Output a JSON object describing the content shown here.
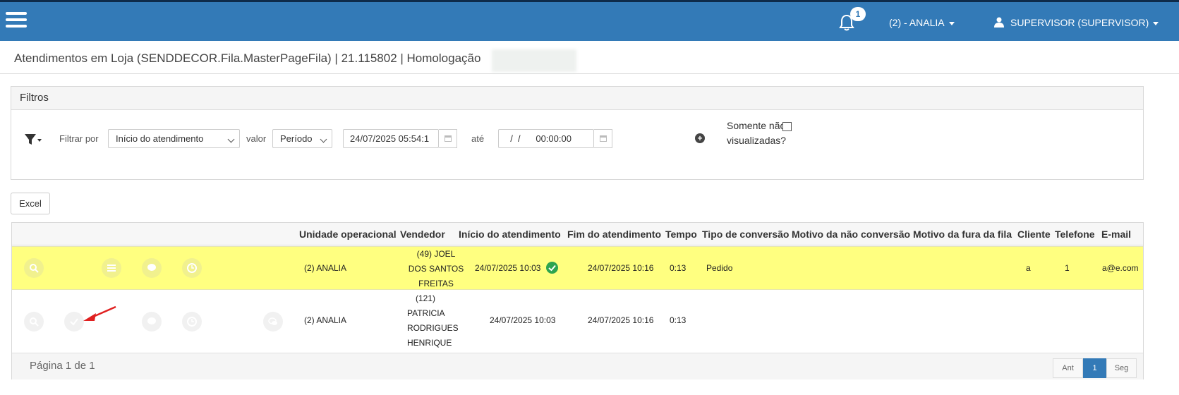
{
  "topbar": {
    "notification_count": "1",
    "unit_menu_label": "(2) - ANALIA",
    "user_menu_label": "SUPERVISOR (SUPERVISOR)",
    "brand_color": "#337ab7"
  },
  "page": {
    "title": "Atendimentos em Loja (SENDDECOR.Fila.MasterPageFila) | 21.115802 | Homologação"
  },
  "filters": {
    "heading": "Filtros",
    "filter_by_label": "Filtrar por",
    "filter_by_value": "Início do atendimento",
    "value_label": "valor",
    "value_mode": "Período",
    "date_from": "24/07/2025 05:54:1",
    "until_label": "até",
    "date_to": "  /  /      00:00:00",
    "only_unviewed_label": "Somente não visualizadas?"
  },
  "actions": {
    "excel_label": "Excel"
  },
  "table": {
    "columns": [
      "Unidade operacional",
      "Vendedor",
      "Início do atendimento",
      "Fim do atendimento",
      "Tempo",
      "Tipo de conversão",
      "Motivo da não conversão",
      "Motivo da fura da fila",
      "Cliente",
      "Telefone",
      "E-mail"
    ],
    "rows": [
      {
        "unit": "(2) ANALIA",
        "seller_lines": [
          "(49) JOEL",
          "DOS SANTOS",
          "FREITAS"
        ],
        "start": "24/07/2025 10:03",
        "end": "24/07/2025 10:16",
        "duration": "0:13",
        "conversion": "Pedido",
        "client": "a",
        "phone": "1",
        "email": "a@e.com",
        "highlight_color": "#ffff80"
      },
      {
        "unit": "(2) ANALIA",
        "seller_lines": [
          "(121)",
          "PATRICIA",
          "RODRIGUES",
          "HENRIQUE"
        ],
        "start": "24/07/2025 10:03",
        "end": "24/07/2025 10:16",
        "duration": "0:13",
        "conversion": "",
        "client": "",
        "phone": "",
        "email": ""
      }
    ]
  },
  "pagination": {
    "info": "Página 1 de 1",
    "prev": "Ant",
    "current": "1",
    "next": "Seg"
  }
}
